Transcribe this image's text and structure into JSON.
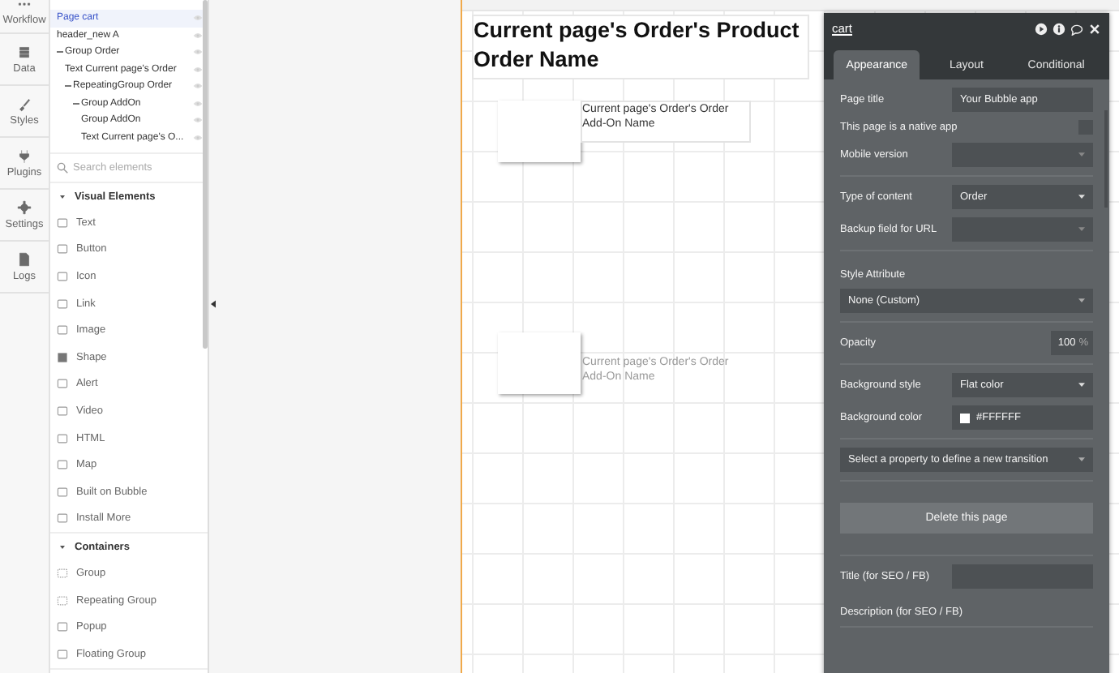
{
  "nav": [
    {
      "label": "Workflow"
    },
    {
      "label": "Data"
    },
    {
      "label": "Styles"
    },
    {
      "label": "Plugins"
    },
    {
      "label": "Settings"
    },
    {
      "label": "Logs"
    }
  ],
  "element_tree": [
    {
      "label": "Page cart",
      "selected": true
    },
    {
      "label": "header_new A",
      "selected": false
    },
    {
      "label": "Group Order",
      "selected": false,
      "expanded": true,
      "children": [
        {
          "label": "Text Current page's Order",
          "selected": false
        },
        {
          "label": "RepeatingGroup Order",
          "selected": false,
          "expanded": true,
          "children": [
            {
              "label": "Group AddOn",
              "selected": false,
              "expanded": true,
              "children": [
                {
                  "label": "Group AddOn",
                  "selected": false
                },
                {
                  "label": "Text Current page's O...",
                  "selected": false
                }
              ]
            }
          ]
        }
      ]
    }
  ],
  "search": {
    "placeholder": "Search elements"
  },
  "palette": [
    {
      "title": "Visual Elements",
      "expanded": true,
      "items": [
        "Text",
        "Button",
        "Icon",
        "Link",
        "Image",
        "Shape",
        "Alert",
        "Video",
        "HTML",
        "Map",
        "Built on Bubble",
        "Install More"
      ]
    },
    {
      "title": "Containers",
      "expanded": true,
      "items": [
        "Group",
        "Repeating Group",
        "Popup",
        "Floating Group"
      ]
    }
  ],
  "canvas": {
    "header_text": "Current page's Order's Product Order Name",
    "addon_cells": [
      {
        "text": "Current page's Order's Order Add-On Name",
        "dimmed": false
      },
      {
        "text": "Current page's Order's Order Add-On Name",
        "dimmed": true
      }
    ]
  },
  "property_editor": {
    "title": "cart",
    "tabs": [
      {
        "label": "Appearance",
        "selected": true
      },
      {
        "label": "Layout",
        "selected": false
      },
      {
        "label": "Conditional",
        "selected": false
      }
    ],
    "groups": [
      [
        {
          "kind": "input",
          "label": "Page title",
          "value": "Your Bubble app"
        },
        {
          "kind": "checkbox",
          "label": "This page is a native app",
          "checked": false
        },
        {
          "kind": "dropdown",
          "label": "Mobile version"
        }
      ],
      [
        {
          "kind": "dropdown",
          "label": "Type of content",
          "value": "Order"
        },
        {
          "kind": "dropdown",
          "label": "Backup field for URL"
        }
      ],
      [
        {
          "kind": "heading",
          "label": "Style Attribute"
        },
        {
          "kind": "wide_dropdown",
          "value": "None (Custom)"
        }
      ],
      [
        {
          "kind": "percent",
          "label": "Opacity",
          "value": "100",
          "unit": "%"
        }
      ],
      [
        {
          "kind": "dropdown",
          "label": "Background style",
          "value": "Flat color"
        },
        {
          "kind": "color",
          "label": "Background color",
          "value": "#FFFFFF"
        }
      ],
      [
        {
          "kind": "wide_dropdown",
          "value": "Select a property to define a new transition"
        }
      ],
      [
        {
          "kind": "button",
          "label": "Delete this page"
        }
      ],
      [
        {
          "kind": "input",
          "label": "Title (for SEO / FB)"
        },
        {
          "kind": "heading",
          "label": "Description (for SEO / FB)"
        }
      ]
    ]
  }
}
